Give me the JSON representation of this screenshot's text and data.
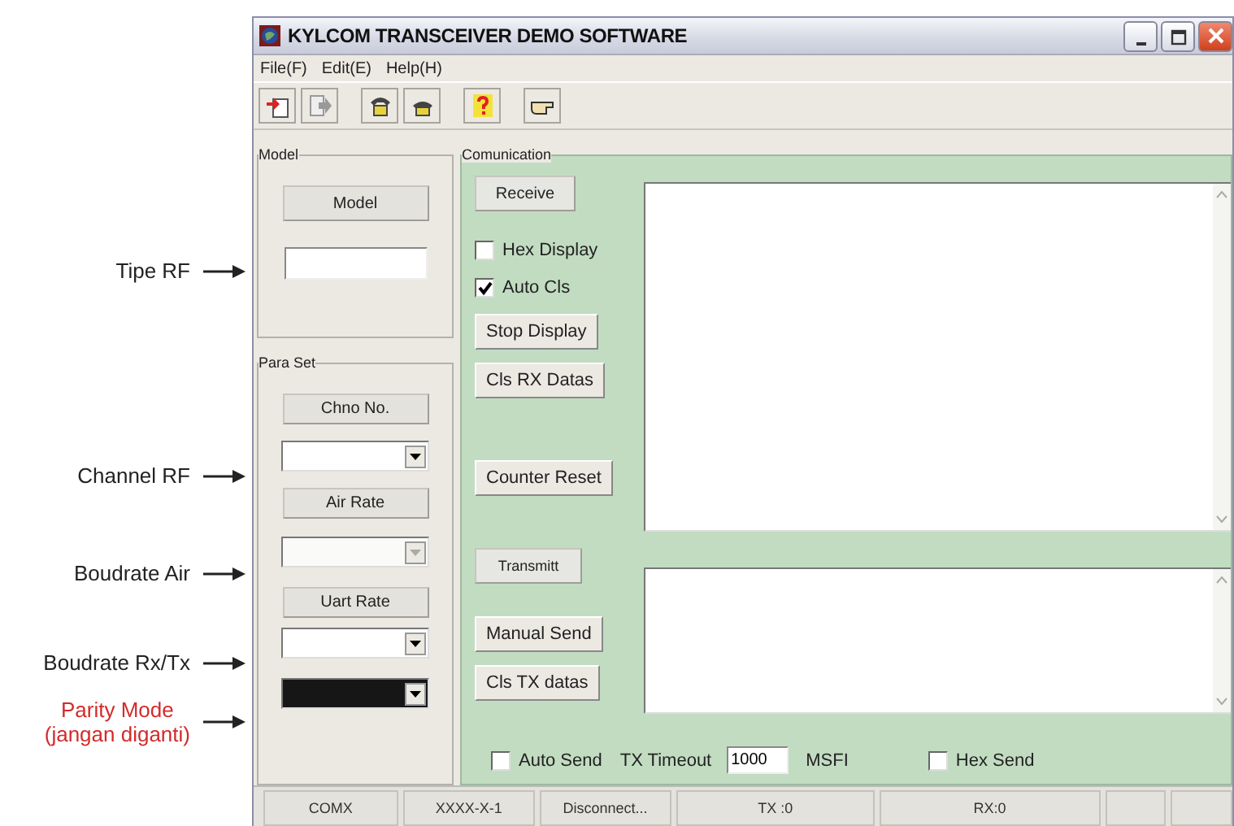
{
  "annotations": [
    {
      "text": "Tipe RF",
      "highlighted": false
    },
    {
      "text": "Channel RF",
      "highlighted": false
    },
    {
      "text": "Boudrate Air",
      "highlighted": false
    },
    {
      "text": "Boudrate Rx/Tx",
      "highlighted": false
    },
    {
      "text": "Parity Mode\n(jangan diganti)",
      "highlighted": true
    }
  ],
  "window": {
    "title": "KYLCOM TRANSCEIVER DEMO SOFTWARE"
  },
  "menu": [
    "File(F)",
    "Edit(E)",
    "Help(H)"
  ],
  "model_group": {
    "title": "Model",
    "button": "Model"
  },
  "para_set": {
    "title": "Para Set",
    "items": [
      {
        "kind": "button",
        "label": "Chno No."
      },
      {
        "kind": "combo",
        "disabled": false,
        "filled": false
      },
      {
        "kind": "button",
        "label": "Air Rate"
      },
      {
        "kind": "combo",
        "disabled": true,
        "filled": false
      },
      {
        "kind": "button",
        "label": "Uart Rate"
      },
      {
        "kind": "combo",
        "disabled": false,
        "filled": false
      },
      {
        "kind": "combo",
        "disabled": false,
        "filled": true
      }
    ]
  },
  "communication": {
    "title": "Comunication",
    "receive": {
      "header": "Receive",
      "options": [
        {
          "label": "Hex Display",
          "checked": false
        },
        {
          "label": "Auto Cls",
          "checked": true
        }
      ],
      "buttons": [
        "Stop Display",
        "Cls RX Datas",
        "Counter Reset"
      ]
    },
    "transmit": {
      "header": "Transmitt",
      "buttons": [
        "Manual Send",
        "Cls TX datas"
      ]
    },
    "auto_send": {
      "label": "Auto Send",
      "checked": false
    },
    "tx_timeout": {
      "label": "TX Timeout",
      "value": "1000",
      "unit": "MSFI"
    },
    "hex_send": {
      "label": "Hex Send",
      "checked": false
    }
  },
  "status_bar": [
    "COMX",
    "XXXX-X-1",
    "Disconnect...",
    "TX :0",
    "RX:0"
  ]
}
